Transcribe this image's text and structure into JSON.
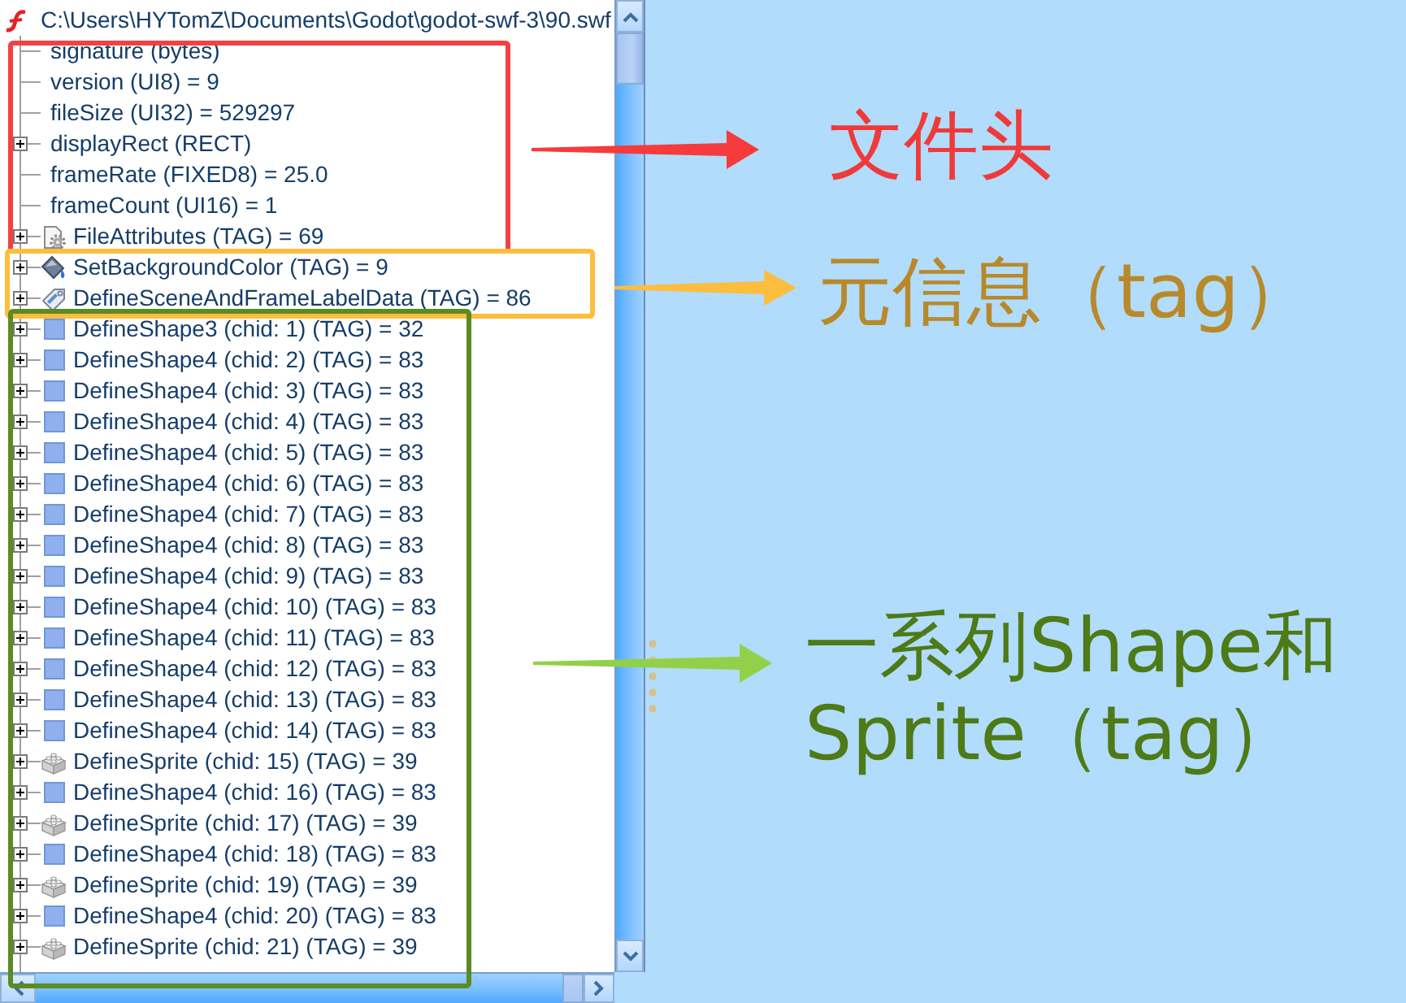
{
  "tree": {
    "root": {
      "label": "C:\\Users\\HYTomZ\\Documents\\Godot\\godot-swf-3\\90.swf",
      "children": [
        {
          "label": "signature (bytes)",
          "kind": "field"
        },
        {
          "label": "version (UI8) = 9",
          "kind": "field"
        },
        {
          "label": "fileSize (UI32) = 529297",
          "kind": "field"
        },
        {
          "label": "displayRect (RECT)",
          "kind": "field",
          "expanded": false
        },
        {
          "label": "frameRate (FIXED8) = 25.0",
          "kind": "field"
        },
        {
          "label": "frameCount (UI16) = 1",
          "kind": "field"
        },
        {
          "label": "FileAttributes (TAG) = 69",
          "kind": "attributes",
          "expanded": false
        },
        {
          "label": "SetBackgroundColor (TAG) = 9",
          "kind": "background",
          "expanded": false
        },
        {
          "label": "DefineSceneAndFrameLabelData (TAG) = 86",
          "kind": "label",
          "expanded": false
        },
        {
          "label": "DefineShape3 (chid: 1) (TAG) = 32",
          "kind": "shape",
          "expanded": false
        },
        {
          "label": "DefineShape4 (chid: 2) (TAG) = 83",
          "kind": "shape",
          "expanded": false
        },
        {
          "label": "DefineShape4 (chid: 3) (TAG) = 83",
          "kind": "shape",
          "expanded": false
        },
        {
          "label": "DefineShape4 (chid: 4) (TAG) = 83",
          "kind": "shape",
          "expanded": false
        },
        {
          "label": "DefineShape4 (chid: 5) (TAG) = 83",
          "kind": "shape",
          "expanded": false
        },
        {
          "label": "DefineShape4 (chid: 6) (TAG) = 83",
          "kind": "shape",
          "expanded": false
        },
        {
          "label": "DefineShape4 (chid: 7) (TAG) = 83",
          "kind": "shape",
          "expanded": false
        },
        {
          "label": "DefineShape4 (chid: 8) (TAG) = 83",
          "kind": "shape",
          "expanded": false
        },
        {
          "label": "DefineShape4 (chid: 9) (TAG) = 83",
          "kind": "shape",
          "expanded": false
        },
        {
          "label": "DefineShape4 (chid: 10) (TAG) = 83",
          "kind": "shape",
          "expanded": false
        },
        {
          "label": "DefineShape4 (chid: 11) (TAG) = 83",
          "kind": "shape",
          "expanded": false
        },
        {
          "label": "DefineShape4 (chid: 12) (TAG) = 83",
          "kind": "shape",
          "expanded": false
        },
        {
          "label": "DefineShape4 (chid: 13) (TAG) = 83",
          "kind": "shape",
          "expanded": false
        },
        {
          "label": "DefineShape4 (chid: 14) (TAG) = 83",
          "kind": "shape",
          "expanded": false
        },
        {
          "label": "DefineSprite (chid: 15) (TAG) = 39",
          "kind": "sprite",
          "expanded": false
        },
        {
          "label": "DefineShape4 (chid: 16) (TAG) = 83",
          "kind": "shape",
          "expanded": false
        },
        {
          "label": "DefineSprite (chid: 17) (TAG) = 39",
          "kind": "sprite",
          "expanded": false
        },
        {
          "label": "DefineShape4 (chid: 18) (TAG) = 83",
          "kind": "shape",
          "expanded": false
        },
        {
          "label": "DefineSprite (chid: 19) (TAG) = 39",
          "kind": "sprite",
          "expanded": false
        },
        {
          "label": "DefineShape4 (chid: 20) (TAG) = 83",
          "kind": "shape",
          "expanded": false
        },
        {
          "label": "DefineSprite (chid: 21) (TAG) = 39",
          "kind": "sprite",
          "expanded": false
        }
      ]
    }
  },
  "annotations": [
    {
      "label": "文件头",
      "color": "#f03a3a",
      "frame": {
        "color": "#f44040"
      },
      "arrow": {
        "color": "#f53b3b"
      }
    },
    {
      "label": "元信息（tag）",
      "color": "#b8892b",
      "frame": {
        "color": "#fdbd3e"
      },
      "arrow": {
        "color": "#fdbd3e"
      }
    },
    {
      "label": "一系列Shape和Sprite（tag）",
      "color": "#4e7a17",
      "frame": {
        "color": "#5b8b22"
      },
      "arrow": {
        "color": "#92d04a"
      }
    }
  ]
}
